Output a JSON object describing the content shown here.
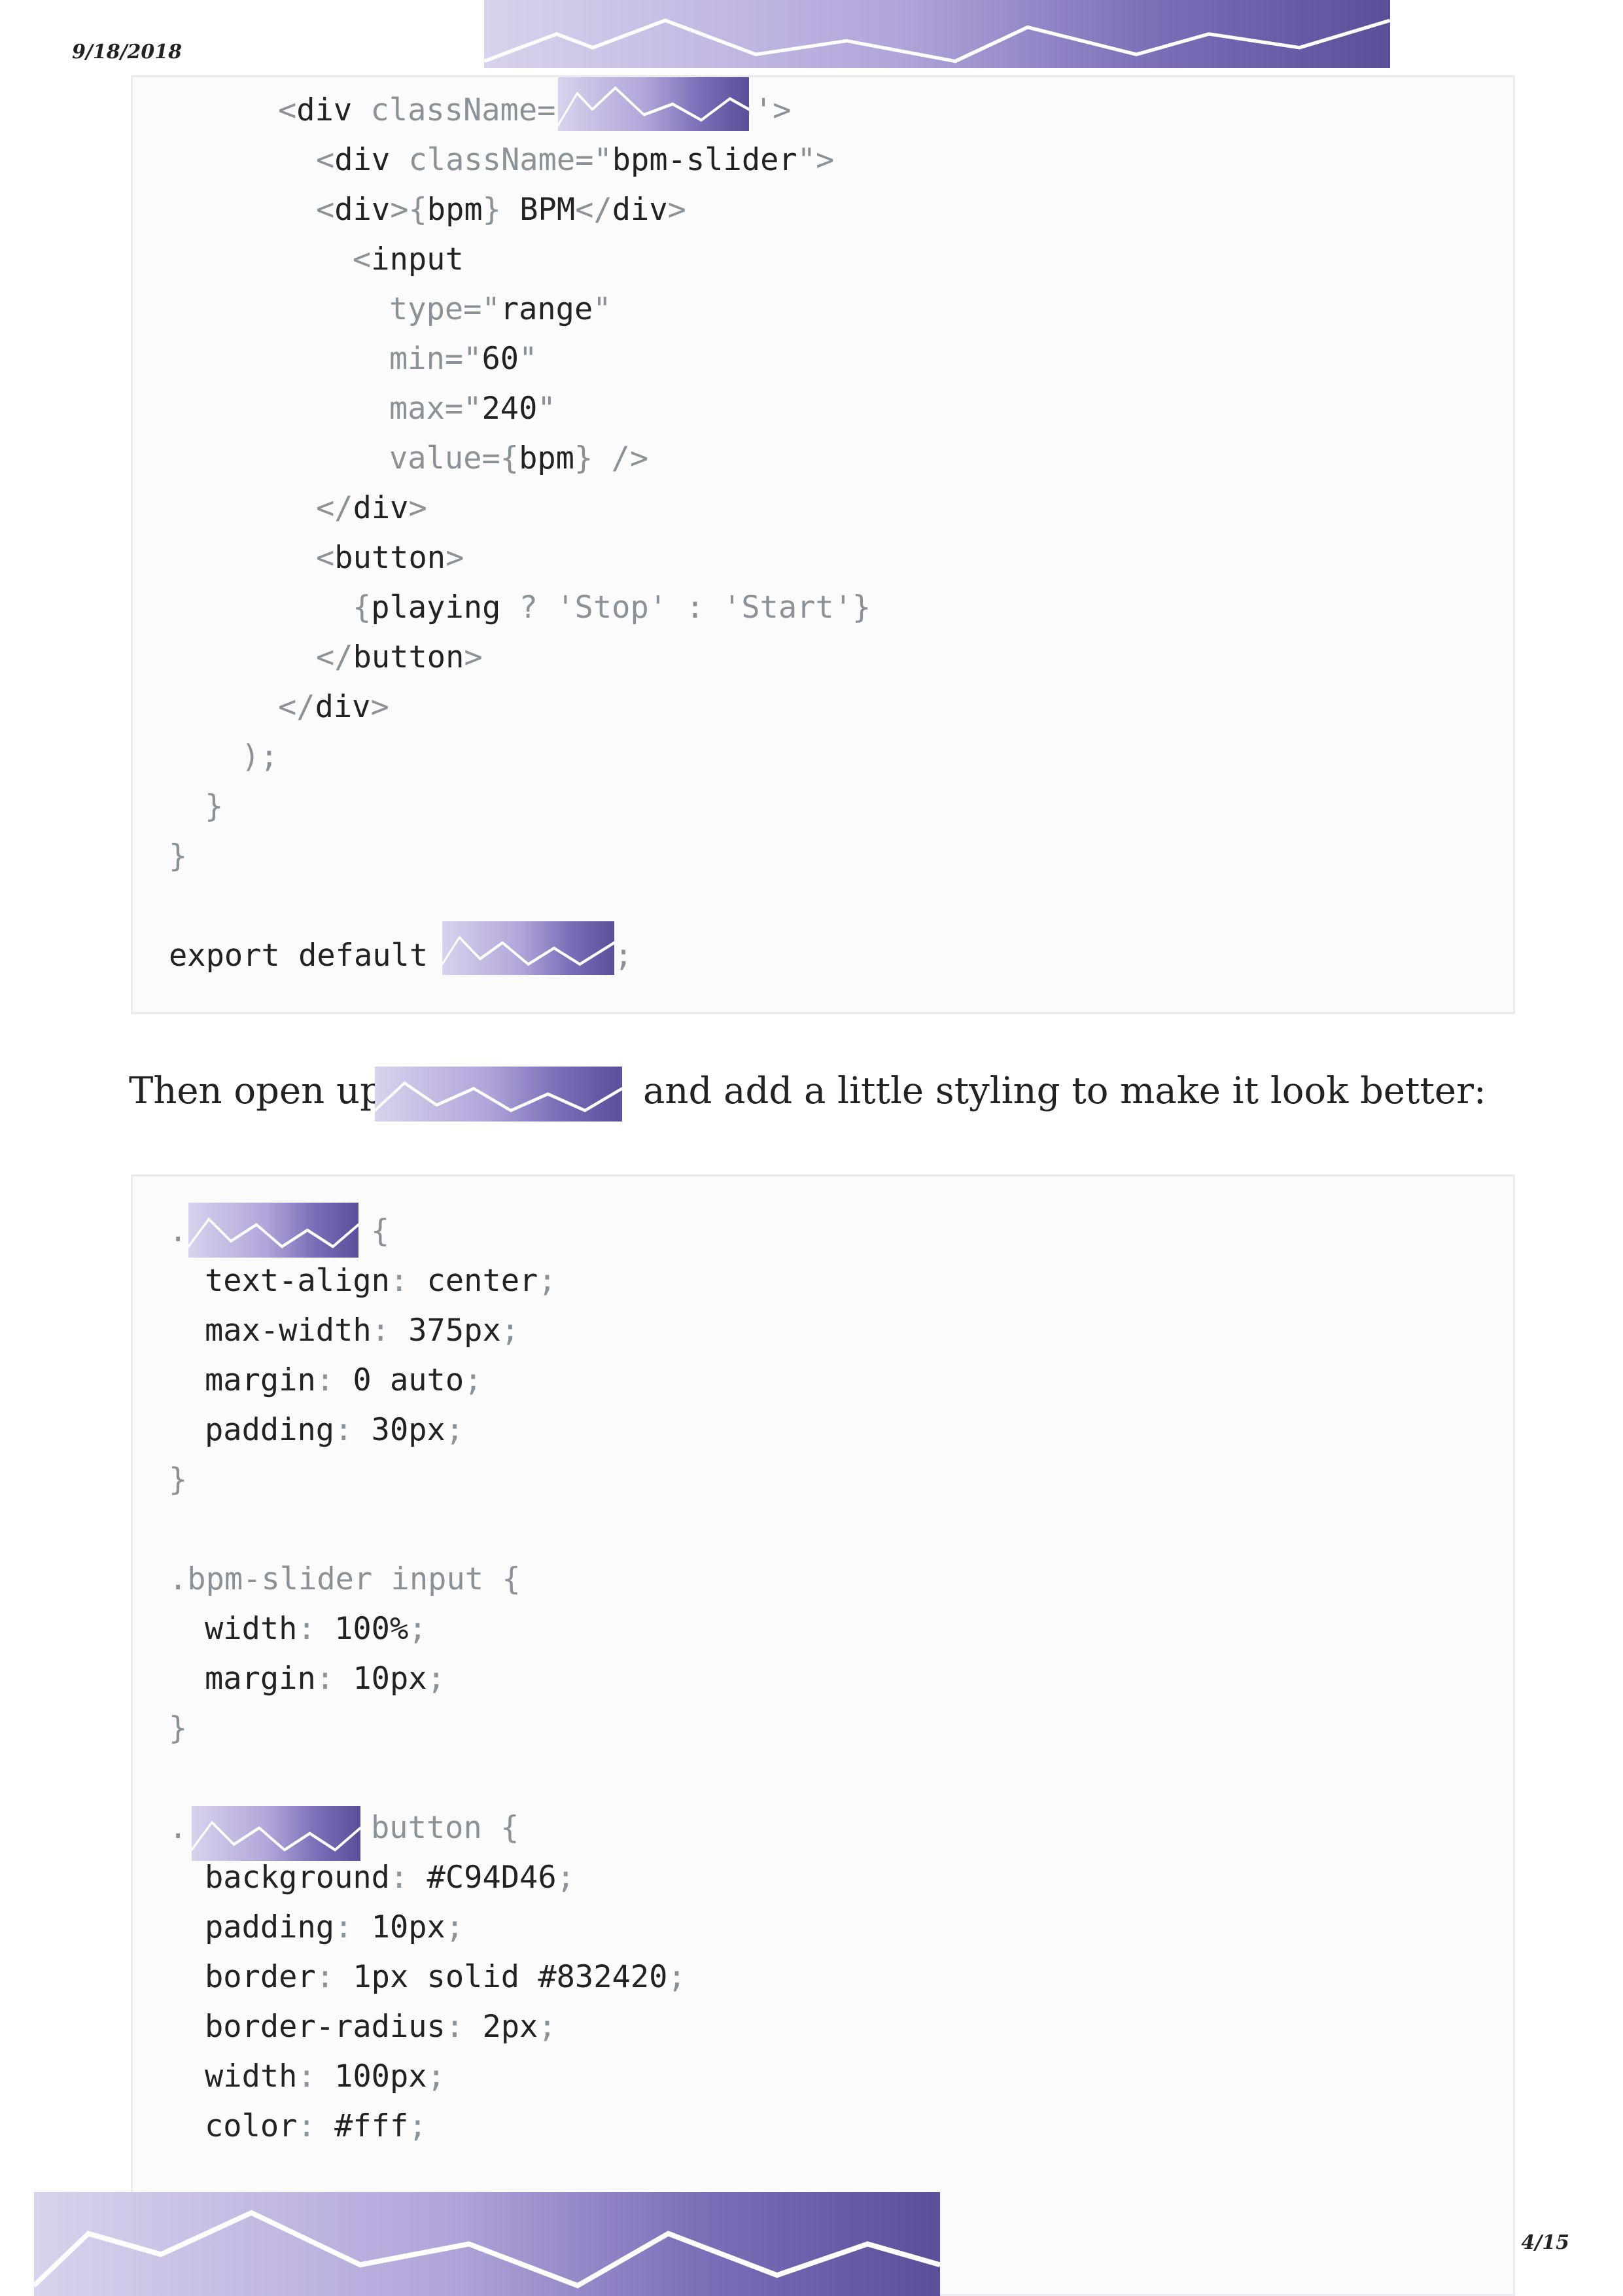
{
  "header": {
    "date": "9/18/2018"
  },
  "footer": {
    "page": "4/15"
  },
  "code_block_1": {
    "lines": [
      [
        "<div className=",
        "'>"
      ],
      [
        "<div className=\"bpm-slider\">"
      ],
      [
        "<div>{bpm} BPM</div>"
      ],
      [
        "<input"
      ],
      [
        "type=\"range\""
      ],
      [
        "min=\"60\""
      ],
      [
        "max=\"240\""
      ],
      [
        "value={bpm} />"
      ],
      [
        "</div>"
      ],
      [
        "<button>"
      ],
      [
        "{playing ? 'Stop' : 'Start'}"
      ],
      [
        "</button>"
      ],
      [
        "</div>"
      ],
      [
        ");"
      ],
      [
        "}"
      ],
      [
        "}"
      ],
      [
        ""
      ],
      [
        "export default",
        ";"
      ]
    ]
  },
  "prose": {
    "before": "Then open up",
    "after": "and add a little styling to make it look better:"
  },
  "code_block_2": {
    "lines": [
      [
        ".",
        "{"
      ],
      [
        "text-align: center;"
      ],
      [
        "max-width: 375px;"
      ],
      [
        "margin: 0 auto;"
      ],
      [
        "padding: 30px;"
      ],
      [
        "}"
      ],
      [
        ""
      ],
      [
        ".bpm-slider input {"
      ],
      [
        "width: 100%;"
      ],
      [
        "margin: 10px;"
      ],
      [
        "}"
      ],
      [
        ""
      ],
      [
        ".",
        "button {"
      ],
      [
        "background: #C94D46;"
      ],
      [
        "padding: 10px;"
      ],
      [
        "border: 1px solid #832420;"
      ],
      [
        "border-radius: 2px;"
      ],
      [
        "width: 100px;"
      ],
      [
        "color: #fff;"
      ]
    ]
  }
}
